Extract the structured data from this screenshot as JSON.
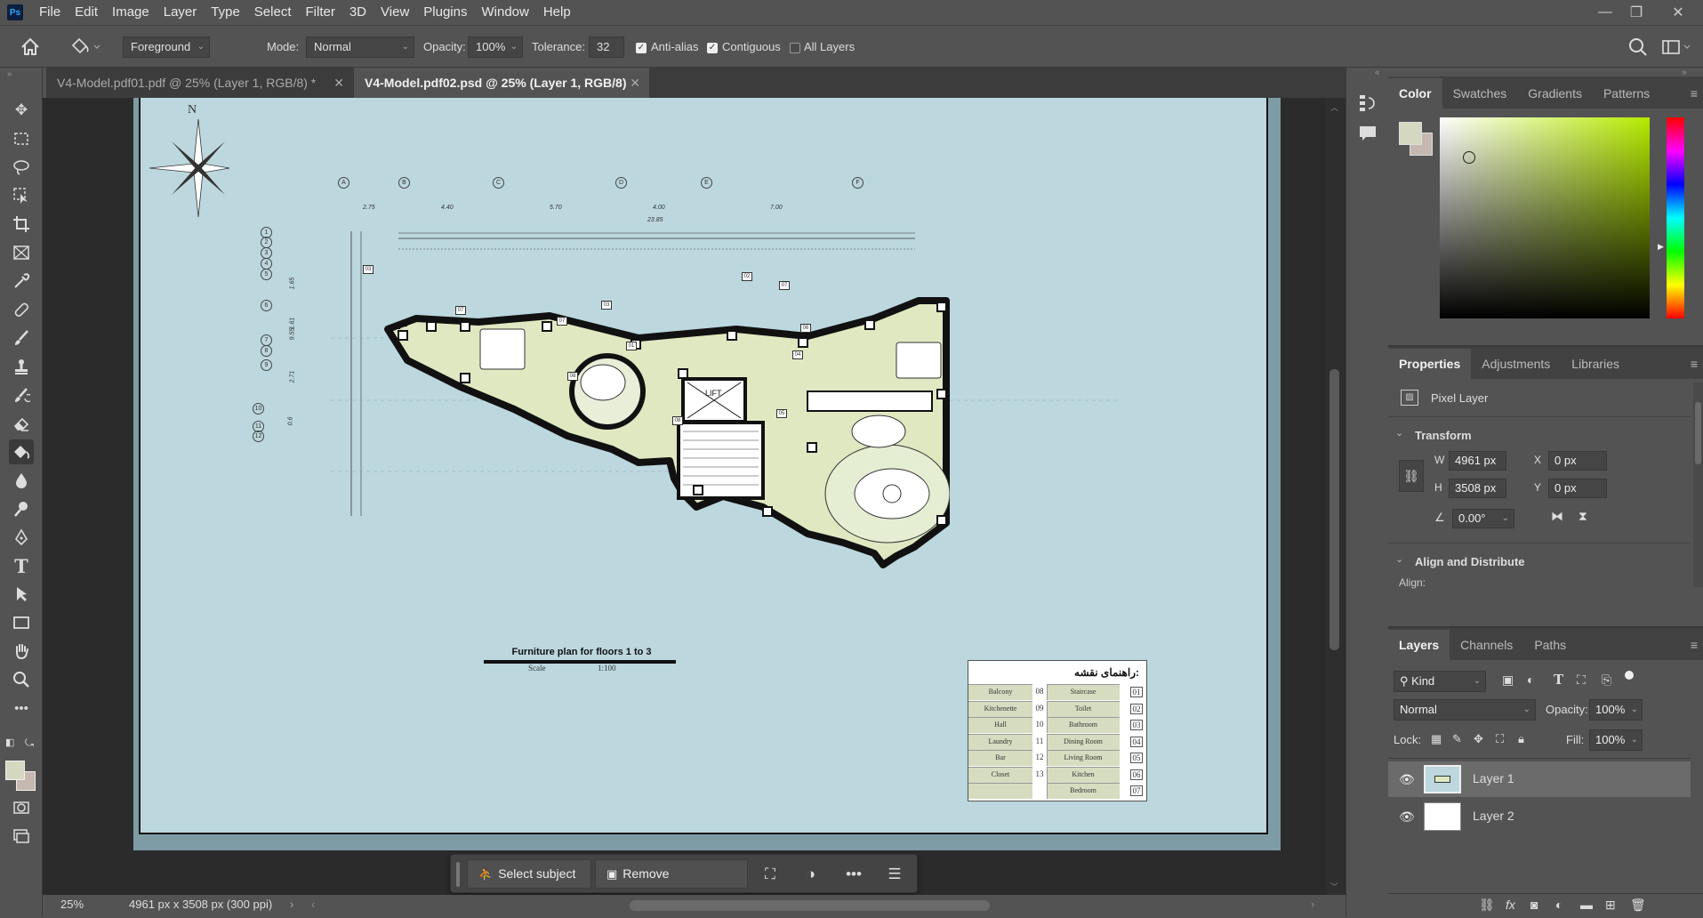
{
  "app": {
    "logo": "Ps",
    "menu": [
      "File",
      "Edit",
      "Image",
      "Layer",
      "Type",
      "Select",
      "Filter",
      "3D",
      "View",
      "Plugins",
      "Window",
      "Help"
    ]
  },
  "window_controls": {
    "minimize": "—",
    "restore": "❐",
    "close": "✕"
  },
  "options": {
    "fill_source": "Foreground",
    "mode_label": "Mode:",
    "mode_value": "Normal",
    "opacity_label": "Opacity:",
    "opacity_value": "100%",
    "tolerance_label": "Tolerance:",
    "tolerance_value": "32",
    "antialias_label": "Anti-alias",
    "antialias_checked": true,
    "contiguous_label": "Contiguous",
    "contiguous_checked": true,
    "alllayers_label": "All Layers",
    "alllayers_checked": false
  },
  "tabs": [
    {
      "label": "V4-Model.pdf01.pdf @ 25% (Layer 1, RGB/8) *",
      "active": false
    },
    {
      "label": "V4-Model.pdf02.psd @ 25% (Layer 1, RGB/8)",
      "active": true
    }
  ],
  "tools": [
    "move-icon",
    "marquee-icon",
    "lasso-icon",
    "object-select-icon",
    "crop-icon",
    "frame-icon",
    "eyedropper-icon",
    "healing-brush-icon",
    "brush-icon",
    "stamp-icon",
    "history-brush-icon",
    "eraser-icon",
    "paint-bucket-icon",
    "blur-icon",
    "dodge-icon",
    "pen-icon",
    "type-icon",
    "path-select-icon",
    "rectangle-icon",
    "hand-icon",
    "zoom-icon",
    "more-icon"
  ],
  "colors": {
    "foreground": "#d4d8c0",
    "background": "#c7b7b1",
    "drawing_bg": "#bcd7de",
    "floor_fill": "#dfe8c0"
  },
  "document": {
    "north": "N",
    "grid_letters": [
      "A",
      "B",
      "C",
      "D",
      "E",
      "F"
    ],
    "grid_numbers": [
      "1",
      "2",
      "3",
      "4",
      "5",
      "6",
      "7",
      "8",
      "9",
      "10",
      "11",
      "12"
    ],
    "dims_top": [
      "2.75",
      "4.40",
      "5.70",
      "4.00",
      "7.00"
    ],
    "dim_total": "23.85",
    "dims_left": [
      "1.65",
      "1.61",
      "9.55",
      "2.71",
      "0.6"
    ],
    "room_tags": [
      "03",
      "07",
      "07",
      "03",
      "02",
      "07",
      "06",
      "04",
      "05",
      "08",
      "08",
      "01"
    ],
    "lift_label": "LIFT",
    "plan_title": "Furniture plan for floors 1 to 3",
    "scale_label": "Scale",
    "scale_value": "1:100",
    "legend_title": "راهنمای نقشه:",
    "legend_left": [
      {
        "name": "Balcony",
        "num": "08"
      },
      {
        "name": "Kitchenette",
        "num": "09"
      },
      {
        "name": "Hall",
        "num": "10"
      },
      {
        "name": "Laundry",
        "num": "11"
      },
      {
        "name": "Bar",
        "num": "12"
      },
      {
        "name": "Closet",
        "num": "13"
      },
      {
        "name": "",
        "num": ""
      }
    ],
    "legend_right": [
      {
        "name": "Staircase",
        "num": "01"
      },
      {
        "name": "Toilet",
        "num": "02"
      },
      {
        "name": "Bathroom",
        "num": "03"
      },
      {
        "name": "Dining Room",
        "num": "04"
      },
      {
        "name": "Living Room",
        "num": "05"
      },
      {
        "name": "Kitchen",
        "num": "06"
      },
      {
        "name": "Bedroom",
        "num": "07"
      }
    ]
  },
  "contextual_taskbar": {
    "select_subject": "Select subject",
    "remove_background": "Remove background"
  },
  "status": {
    "zoom": "25%",
    "doc_info": "4961 px x 3508 px (300 ppi)"
  },
  "color_panel": {
    "tabs": [
      "Color",
      "Swatches",
      "Gradients",
      "Patterns"
    ],
    "active": "Color"
  },
  "properties_panel": {
    "tabs": [
      "Properties",
      "Adjustments",
      "Libraries"
    ],
    "layer_type": "Pixel Layer",
    "transform_title": "Transform",
    "w_label": "W",
    "w_value": "4961 px",
    "h_label": "H",
    "h_value": "3508 px",
    "x_label": "X",
    "x_value": "0 px",
    "y_label": "Y",
    "y_value": "0 px",
    "angle_value": "0.00°",
    "align_title": "Align and Distribute",
    "align_label": "Align:"
  },
  "layers_panel": {
    "tabs": [
      "Layers",
      "Channels",
      "Paths"
    ],
    "filter_kind": "Kind",
    "blend_mode": "Normal",
    "opacity_label": "Opacity:",
    "opacity_value": "100%",
    "lock_label": "Lock:",
    "fill_label": "Fill:",
    "fill_value": "100%",
    "layers": [
      {
        "name": "Layer 1",
        "selected": true
      },
      {
        "name": "Layer 2",
        "selected": false
      }
    ]
  }
}
